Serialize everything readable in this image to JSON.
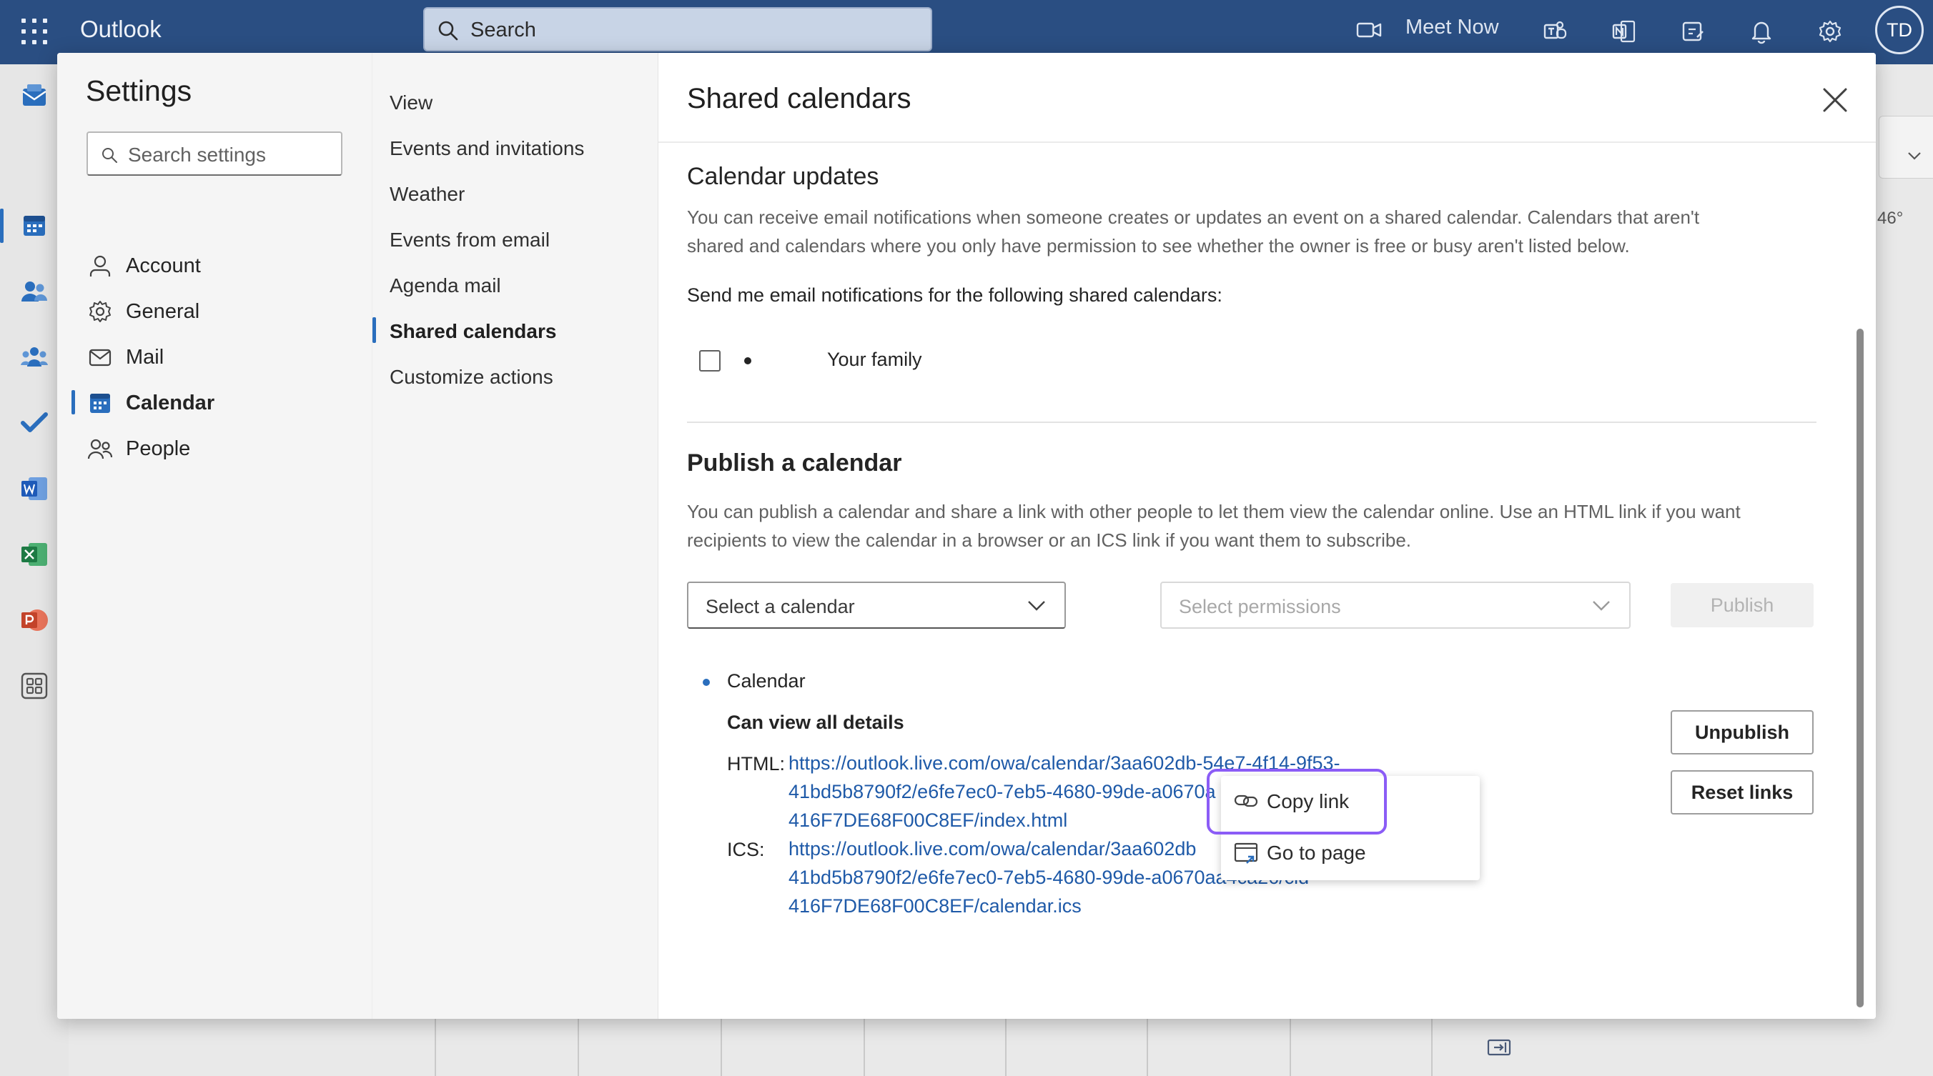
{
  "app": {
    "name": "Outlook",
    "search_placeholder": "Search",
    "meet_now": "Meet Now",
    "avatar_initials": "TD",
    "background_temp": "46°"
  },
  "colors": {
    "topbar": "#2a4e82",
    "accent": "#2a6ebd",
    "link": "#1f5aa8",
    "highlight": "#8b5cf6"
  },
  "settings": {
    "title": "Settings",
    "search_placeholder": "Search settings",
    "categories": [
      {
        "label": "Account",
        "icon": "person-icon"
      },
      {
        "label": "General",
        "icon": "gear-icon"
      },
      {
        "label": "Mail",
        "icon": "mail-icon"
      },
      {
        "label": "Calendar",
        "icon": "calendar-icon",
        "active": true
      },
      {
        "label": "People",
        "icon": "people-icon"
      }
    ],
    "subsections": [
      {
        "label": "View"
      },
      {
        "label": "Events and invitations"
      },
      {
        "label": "Weather"
      },
      {
        "label": "Events from email"
      },
      {
        "label": "Agenda mail"
      },
      {
        "label": "Shared calendars",
        "active": true
      },
      {
        "label": "Customize actions"
      }
    ]
  },
  "content": {
    "title": "Shared calendars",
    "calendar_updates": {
      "heading": "Calendar updates",
      "description_line1": "You can receive email notifications when someone creates or updates an event on a shared calendar. Calendars that aren't",
      "description_line2": "shared and calendars where you only have permission to see whether the owner is free or busy aren't listed below.",
      "prompt": "Send me email notifications for the following shared calendars:",
      "calendars": [
        {
          "name": "Your family",
          "checked": false
        }
      ]
    },
    "publish": {
      "heading": "Publish a calendar",
      "description_line1": "You can publish a calendar and share a link with other people to let them view the calendar online. Use an HTML link if you want",
      "description_line2": "recipients to view the calendar in a browser or an ICS link if you want them to subscribe.",
      "select_calendar": "Select a calendar",
      "select_permissions": "Select permissions",
      "publish_button": "Publish",
      "published": {
        "calendar_name": "Calendar",
        "permission": "Can view all details",
        "html_label": "HTML:",
        "html_link_line1": "https://outlook.live.com/owa/calendar/3aa602db-54e7-4f14-9f53-",
        "html_link_line2": "41bd5b8790f2/e6fe7ec0-7eb5-4680-99de-a0670a",
        "html_link_line3": "416F7DE68F00C8EF/index.html",
        "ics_label": "ICS:",
        "ics_link_line1": "https://outlook.live.com/owa/calendar/3aa602db",
        "ics_link_line2": "41bd5b8790f2/e6fe7ec0-7eb5-4680-99de-a0670aa4ca26/cid-",
        "ics_link_line3": "416F7DE68F00C8EF/calendar.ics",
        "unpublish_button": "Unpublish",
        "reset_links_button": "Reset links"
      }
    }
  },
  "context_menu": {
    "items": [
      {
        "label": "Copy link",
        "icon": "link-icon"
      },
      {
        "label": "Go to page",
        "icon": "open-page-icon"
      }
    ]
  }
}
